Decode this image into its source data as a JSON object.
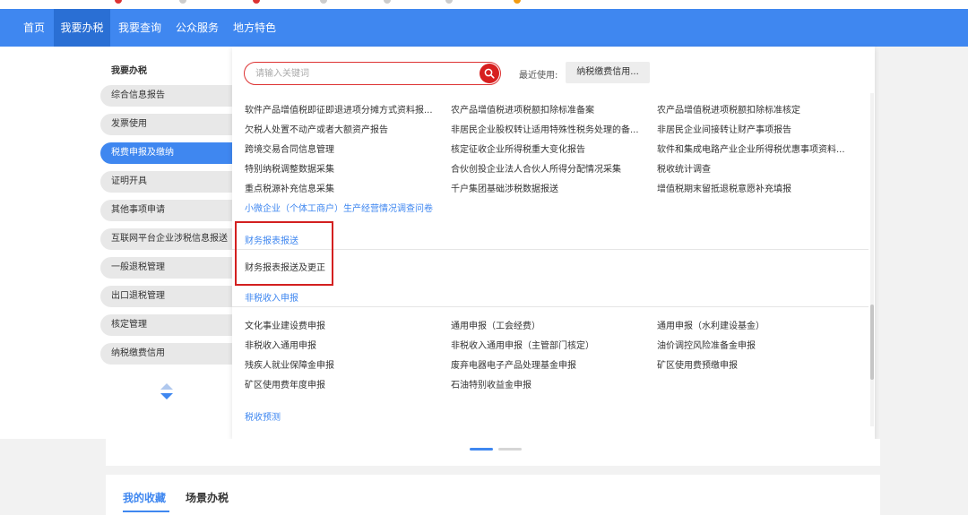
{
  "nav": {
    "items": [
      {
        "label": "首页"
      },
      {
        "label": "我要办税",
        "active": true
      },
      {
        "label": "我要查询"
      },
      {
        "label": "公众服务"
      },
      {
        "label": "地方特色"
      }
    ]
  },
  "sidebar": {
    "title": "我要办税",
    "items": [
      {
        "label": "综合信息报告"
      },
      {
        "label": "发票使用"
      },
      {
        "label": "税费申报及缴纳",
        "active": true
      },
      {
        "label": "证明开具"
      },
      {
        "label": "其他事项申请"
      },
      {
        "label": "互联网平台企业涉税信息报送"
      },
      {
        "label": "一般退税管理"
      },
      {
        "label": "出口退税管理"
      },
      {
        "label": "核定管理"
      },
      {
        "label": "纳税缴费信用"
      }
    ]
  },
  "search": {
    "placeholder": "请输入关键词",
    "recent_label": "最近使用:",
    "recent_tag": "纳税缴费信用..."
  },
  "links": {
    "rows": [
      [
        "软件产品增值税即征即退进项分摊方式资料报...",
        "农产品增值税进项税额扣除标准备案",
        "农产品增值税进项税额扣除标准核定"
      ],
      [
        "欠税人处置不动产或者大额资产报告",
        "非居民企业股权转让适用特殊性税务处理的备...",
        "非居民企业间接转让财产事项报告"
      ],
      [
        "跨境交易合同信息管理",
        "核定征收企业所得税重大变化报告",
        "软件和集成电路产业企业所得税优惠事项资料..."
      ],
      [
        "特别纳税调整数据采集",
        "合伙创投企业法人合伙人所得分配情况采集",
        "税收统计调查"
      ],
      [
        "重点税源补充信息采集",
        "千户集团基础涉税数据报送",
        "增值税期末留抵退税意愿补充填报"
      ]
    ],
    "survey": "小微企业（个体工商户）生产经营情况调查问卷"
  },
  "financial": {
    "title": "财务报表报送",
    "item": "财务报表报送及更正"
  },
  "nontax": {
    "title": "非税收入申报",
    "rows": [
      [
        "文化事业建设费申报",
        "通用申报（工会经费）",
        "通用申报（水利建设基金）"
      ],
      [
        "非税收入通用申报",
        "非税收入通用申报（主管部门核定）",
        "油价调控风险准备金申报"
      ],
      [
        "残疾人就业保障金申报",
        "废弃电器电子产品处理基金申报",
        "矿区使用费预缴申报"
      ],
      [
        "矿区使用费年度申报",
        "石油特别收益金申报",
        ""
      ]
    ]
  },
  "forecast": {
    "title": "税收预测"
  },
  "favorites": {
    "tabs": [
      {
        "label": "我的收藏",
        "active": true
      },
      {
        "label": "场景办税"
      }
    ]
  },
  "colors": {
    "primary": "#3f87f0",
    "nav_active": "#2a6fd4",
    "highlight": "#d32020",
    "search_btn": "#d71f1f"
  }
}
